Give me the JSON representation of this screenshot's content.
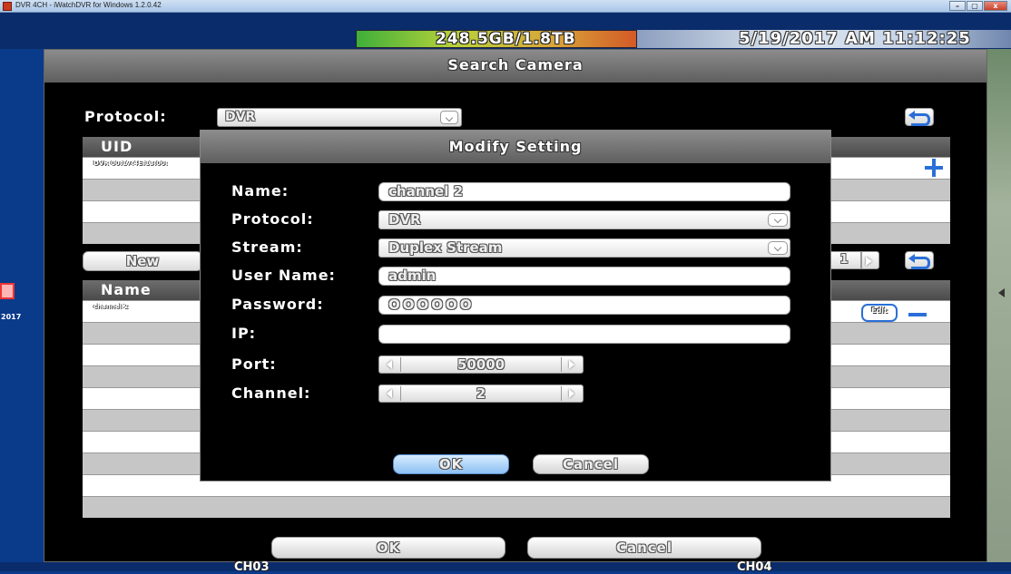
{
  "window": {
    "title": "DVR 4CH - iWatchDVR for Windows 1.2.0.42",
    "buttons": [
      "–",
      "▢",
      "x"
    ]
  },
  "status": {
    "hdd": "248.5GB/1.8TB",
    "clock": "5/19/2017 AM 11:12:25"
  },
  "left": {
    "date": "2017"
  },
  "search_camera": {
    "title": "Search Camera",
    "protocol_label": "Protocol:",
    "protocol_value": "DVR",
    "uid_table": {
      "header": "UID",
      "rows": [
        "DVR 00:17:4E:13:00:"
      ]
    },
    "new_button": "New",
    "page": "1",
    "name_table": {
      "header": "Name",
      "rows": [
        "channel 2"
      ],
      "edit_label": "Edit"
    },
    "ok_button": "OK",
    "cancel_button": "Cancel"
  },
  "modify_setting": {
    "title": "Modify Setting",
    "name_label": "Name:",
    "name_value": "channel 2",
    "protocol_label": "Protocol:",
    "protocol_value": "DVR",
    "stream_label": "Stream:",
    "stream_value": "Duplex Stream",
    "username_label": "User Name:",
    "username_value": "admin",
    "password_label": "Password:",
    "password_value": "OOOOOO",
    "ip_label": "IP:",
    "ip_value": "",
    "port_label": "Port:",
    "port_value": "50000",
    "channel_label": "Channel:",
    "channel_value": "2",
    "ok_button": "OK",
    "cancel_button": "Cancel"
  },
  "bottom": {
    "ch03": "CH03",
    "ch04": "CH04"
  },
  "colors": {
    "accent": "#2a6fd8",
    "background": "#0a3a8a",
    "dialog_bg": "#000000"
  }
}
